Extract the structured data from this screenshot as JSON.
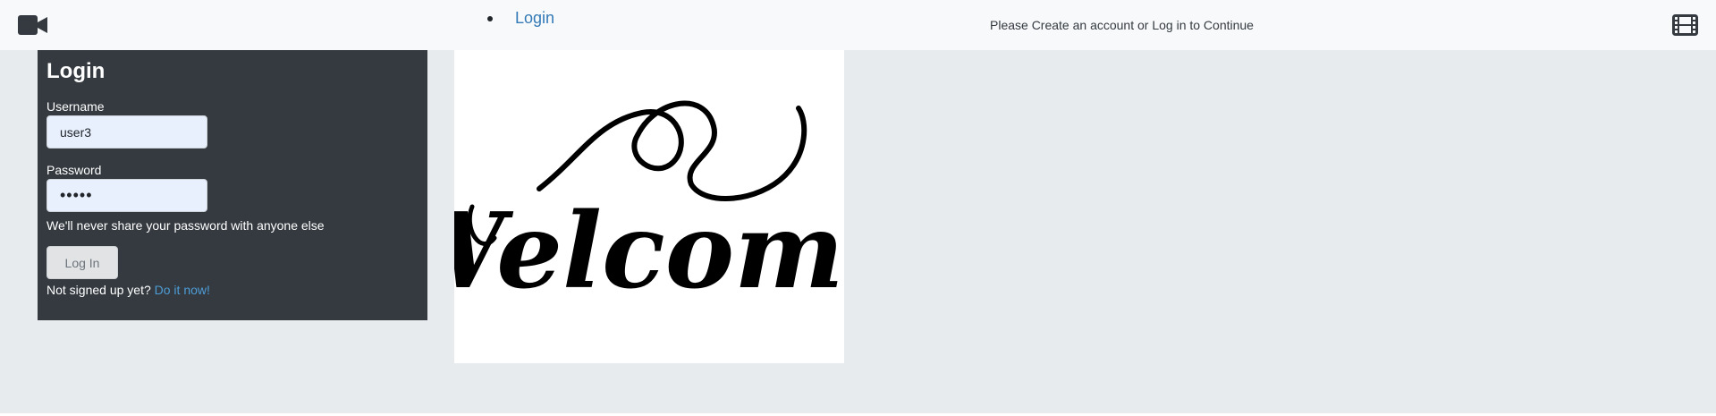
{
  "navbar": {
    "brand_icon": "video-camera-icon",
    "nav_items": [
      {
        "label": "Login"
      }
    ],
    "message": "Please Create an account or Log in to Continue",
    "right_icon": "film-icon"
  },
  "login_form": {
    "title": "Login",
    "username_label": "Username",
    "username_value": "user3",
    "password_label": "Password",
    "password_value": "•••••",
    "help_text": "We'll never share your password with anyone else",
    "submit_label": "Log In",
    "signup_prompt": "Not signed up yet?",
    "signup_link_label": "Do it now!"
  },
  "welcome_image": {
    "text": "Welcome"
  },
  "colors": {
    "navbar_bg": "#f8f9fa",
    "page_bg": "#e8ebee",
    "panel_bg": "#343a40",
    "link": "#337ab7",
    "input_bg": "#e8f0fe"
  }
}
